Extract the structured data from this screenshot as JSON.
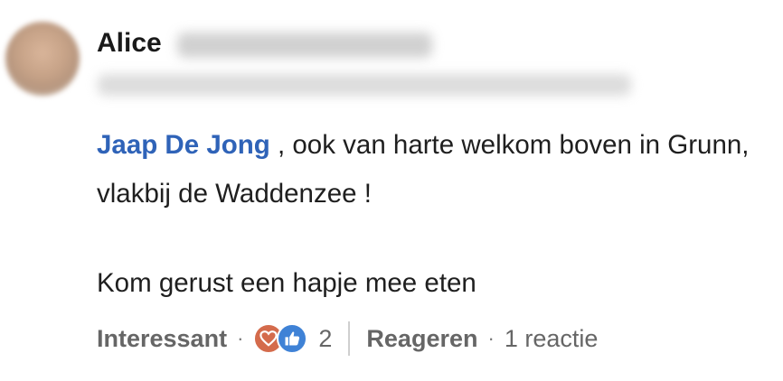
{
  "comment": {
    "author_name": "Alice",
    "mention": "Jaap De Jong",
    "text_line1": " , ook van harte welkom boven in Grunn, vlakbij de Waddenzee !",
    "text_line2": "Kom gerust een hapje mee eten"
  },
  "actions": {
    "interesting_label": "Interessant",
    "separator": "·",
    "reaction_icons": [
      "heart-icon",
      "thumbs-up-icon"
    ],
    "reaction_count": "2",
    "reply_label": "Reageren",
    "reply_count": "1 reactie"
  },
  "colors": {
    "mention": "#2f63b8",
    "love_reaction": "#d46b4c",
    "like_reaction": "#3f82d6",
    "muted_text": "#666666"
  }
}
